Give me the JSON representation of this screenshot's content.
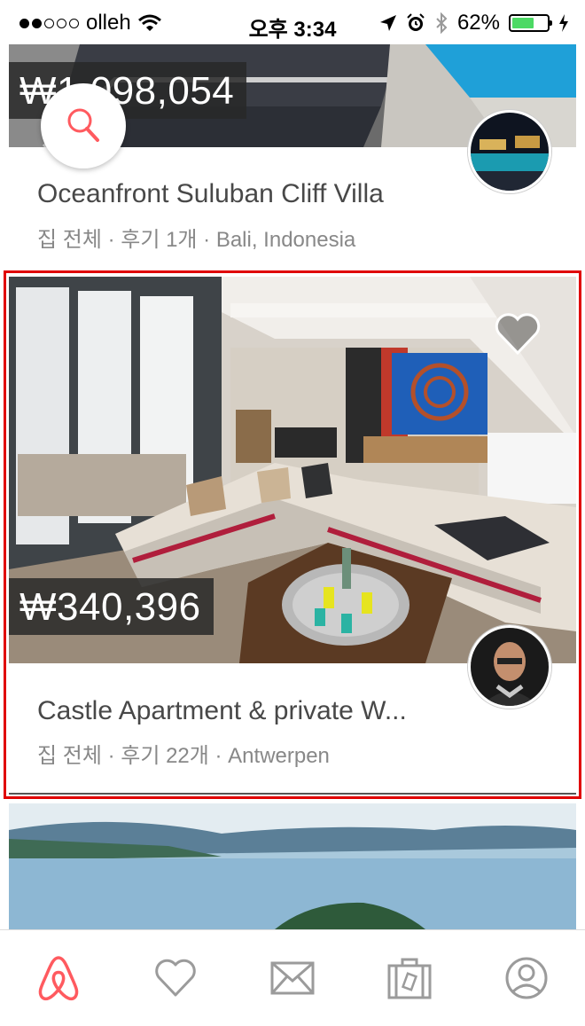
{
  "status_bar": {
    "carrier": "olleh",
    "time": "오후 3:34",
    "battery": "62%",
    "battery_level": 0.62,
    "icons": [
      "signal-dots",
      "wifi-icon",
      "location-arrow-icon",
      "alarm-icon",
      "bluetooth-icon",
      "battery-icon",
      "charging-icon"
    ]
  },
  "listings": [
    {
      "price": "₩1,098,054",
      "title": "Oceanfront  Suluban Cliff Villa",
      "subtitle": "집 전체 · 후기 1개 · Bali, Indonesia"
    },
    {
      "price": "₩340,396",
      "title": "Castle Apartment & private W...",
      "subtitle": "집 전체 · 후기 22개 · Antwerpen",
      "favorite": false
    }
  ],
  "colors": {
    "brand": "#ff5a5f",
    "highlight": "#e00000",
    "icon_gray": "#9b9b9b"
  },
  "tab_bar": {
    "items": [
      {
        "name": "explore",
        "icon": "airbnb-logo-icon",
        "active": true
      },
      {
        "name": "wishlists",
        "icon": "heart-icon",
        "active": false
      },
      {
        "name": "inbox",
        "icon": "envelope-icon",
        "active": false
      },
      {
        "name": "trips",
        "icon": "suitcase-icon",
        "active": false
      },
      {
        "name": "profile",
        "icon": "user-circle-icon",
        "active": false
      }
    ]
  }
}
